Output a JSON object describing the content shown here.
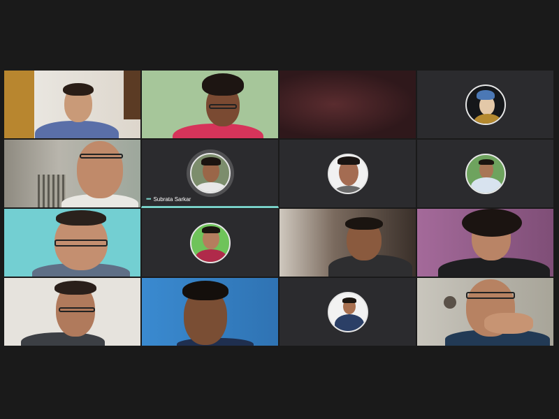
{
  "meeting": {
    "participants": [
      {
        "id": "p1",
        "type": "video",
        "bg": "#c7b8a6"
      },
      {
        "id": "p2",
        "type": "video",
        "bg": "#a7c79b"
      },
      {
        "id": "p3",
        "type": "video",
        "bg": "#3a1f22"
      },
      {
        "id": "p4",
        "type": "avatar",
        "avatar": "painting-portrait"
      },
      {
        "id": "p5",
        "type": "video",
        "bg": "#9aa39c"
      },
      {
        "id": "p6",
        "type": "avatar",
        "name": "Subrata Sarkar",
        "active": true,
        "avatar": "profile-photo"
      },
      {
        "id": "p7",
        "type": "avatar",
        "avatar": "profile-photo"
      },
      {
        "id": "p8",
        "type": "avatar",
        "avatar": "profile-photo"
      },
      {
        "id": "p9",
        "type": "video",
        "bg": "#7fd1d3"
      },
      {
        "id": "p10",
        "type": "avatar",
        "avatar": "profile-photo"
      },
      {
        "id": "p11",
        "type": "video",
        "bg": "#4a4038"
      },
      {
        "id": "p12",
        "type": "video",
        "bg": "#a46a9a"
      },
      {
        "id": "p13",
        "type": "video",
        "bg": "#e7e3dc"
      },
      {
        "id": "p14",
        "type": "video",
        "bg": "#2e7fc0"
      },
      {
        "id": "p15",
        "type": "avatar",
        "avatar": "profile-photo"
      },
      {
        "id": "p16",
        "type": "video",
        "bg": "#bdb9ac"
      }
    ],
    "active_speaker": {
      "name": "Subrata Sarkar",
      "indicator_icon": "more-dots-icon"
    }
  },
  "colors": {
    "background": "#1a1a1a",
    "tile_empty": "#2b2b2e",
    "accent": "#79d1c8"
  }
}
